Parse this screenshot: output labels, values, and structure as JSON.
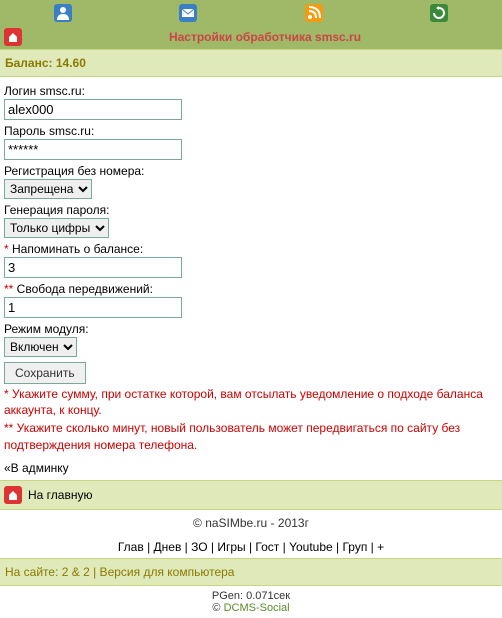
{
  "topbar": {
    "icons": [
      "profile-icon",
      "mail-icon",
      "rss-icon",
      "refresh-icon"
    ]
  },
  "titlebar": {
    "title": "Настройки обработчика smsc.ru"
  },
  "balance": {
    "label": "Баланс: 14.60"
  },
  "form": {
    "login_label": "Логин smsc.ru:",
    "login_value": "alex000",
    "password_label": "Пароль smsc.ru:",
    "password_value": "******",
    "reg_label": "Регистрация без номера:",
    "reg_value": "Запрещена",
    "gen_label": "Генерация пароля:",
    "gen_value": "Только цифры",
    "remind_star": "*",
    "remind_label": " Напоминать о балансе:",
    "remind_value": "3",
    "freedom_star": "**",
    "freedom_label": " Свобода передвижений:",
    "freedom_value": "1",
    "mode_label": "Режим модуля:",
    "mode_value": "Включен",
    "save_button": "Сохранить"
  },
  "notes": {
    "n1": "* Укажите сумму, при остатке которой, вам отсылать уведомление о подходе баланса аккаунта, к концу.",
    "n2": "** Укажите сколько минут, новый пользователь может передвигаться по сайту без подтверждения номера телефона."
  },
  "links": {
    "admin": "«В админку",
    "home": "На главную"
  },
  "footer": {
    "copy": "© naSIMbe.ru - 2013г",
    "nav": "Глав | Днев | ЗО | Игры | Гост | Youtube | Груп | +",
    "online": "На сайте: 2 & 2 | Версия для компьютера",
    "pgen": "PGen: 0.071сек",
    "dcms_prefix": "© ",
    "dcms": "DCMS-Social"
  }
}
